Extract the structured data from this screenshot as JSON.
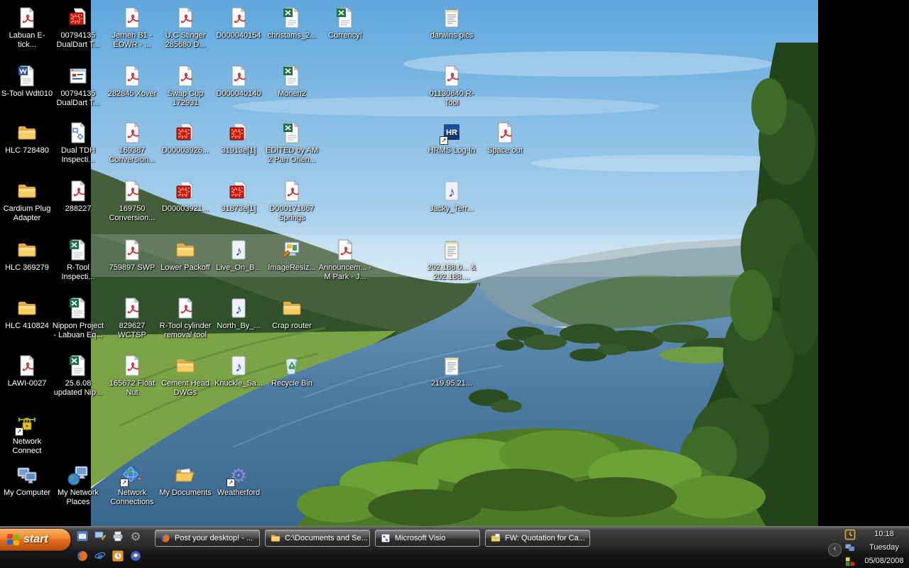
{
  "desktop": {
    "wallpaper_name": "queens-view-loch-tummel",
    "colors": {
      "side_bars": "#000000",
      "sky": "#5ea7dd",
      "water": "#4e7da4",
      "hills": "#44603b",
      "fields": "#7ca446"
    },
    "icons": [
      {
        "label": "Labuan E-tick...",
        "type": "pdf",
        "col": 1,
        "row": 1
      },
      {
        "label": "00794135 DualDart T...",
        "type": "dwg",
        "col": 2,
        "row": 1
      },
      {
        "label": "Jerneh B1 - EOWR - ...",
        "type": "pdf",
        "col": 3,
        "row": 1
      },
      {
        "label": "U.C Stinger 285680 D...",
        "type": "pdf",
        "col": 4,
        "row": 1
      },
      {
        "label": "D000040154",
        "type": "pdf",
        "col": 5,
        "row": 1
      },
      {
        "label": "christams_2...",
        "type": "xls",
        "col": 6,
        "row": 1
      },
      {
        "label": "Currency!",
        "type": "xls",
        "col": 7,
        "row": 1
      },
      {
        "label": "darwins pics",
        "type": "txt",
        "col": 8,
        "row": 1
      },
      {
        "label": "S-Tool Wdt010",
        "type": "doc",
        "col": 1,
        "row": 2
      },
      {
        "label": "00794135 DualDart T...",
        "type": "app",
        "col": 2,
        "row": 2
      },
      {
        "label": "282845 Xover",
        "type": "pdf",
        "col": 3,
        "row": 2
      },
      {
        "label": "Swap Cup 172931",
        "type": "pdf",
        "col": 4,
        "row": 2
      },
      {
        "label": "D000040140",
        "type": "pdf",
        "col": 5,
        "row": 2
      },
      {
        "label": "Moneh2",
        "type": "xls",
        "col": 6,
        "row": 2
      },
      {
        "label": "01130640 R-Tool",
        "type": "pdf",
        "col": 8,
        "row": 2
      },
      {
        "label": "HLC 728480",
        "type": "folder",
        "col": 1,
        "row": 3
      },
      {
        "label": "Dual TDH Inspecti...",
        "type": "visio",
        "col": 2,
        "row": 3
      },
      {
        "label": "169387 Conversion...",
        "type": "pdf",
        "col": 3,
        "row": 3
      },
      {
        "label": "D00003926...",
        "type": "dwg",
        "col": 4,
        "row": 3
      },
      {
        "label": "31913e[1]",
        "type": "dwg",
        "col": 5,
        "row": 3
      },
      {
        "label": "EDITED by AM 2 Pan Orien...",
        "type": "xls",
        "col": 6,
        "row": 3
      },
      {
        "label": "HRMS Log-In",
        "type": "hr",
        "col": 8,
        "row": 3,
        "shortcut": true
      },
      {
        "label": "Space out",
        "type": "pdf",
        "col": 9,
        "row": 3
      },
      {
        "label": "Cardium Plug Adapter",
        "type": "folder",
        "col": 1,
        "row": 4
      },
      {
        "label": "288227",
        "type": "pdf",
        "col": 2,
        "row": 4
      },
      {
        "label": "169750 Conversion...",
        "type": "pdf",
        "col": 3,
        "row": 4
      },
      {
        "label": "D00003921...",
        "type": "dwg",
        "col": 4,
        "row": 4
      },
      {
        "label": "31873e[1]",
        "type": "dwg",
        "col": 5,
        "row": 4
      },
      {
        "label": "D000171867 Springs",
        "type": "pdf",
        "col": 6,
        "row": 4
      },
      {
        "label": "Jacky_Terr...",
        "type": "music",
        "col": 8,
        "row": 4
      },
      {
        "label": "HLC 369279",
        "type": "folder",
        "col": 1,
        "row": 5
      },
      {
        "label": "R-Tool Inspecti...",
        "type": "xls",
        "col": 2,
        "row": 5
      },
      {
        "label": "759897 SWP",
        "type": "pdf",
        "col": 3,
        "row": 5
      },
      {
        "label": "Lower Packoff",
        "type": "folder",
        "col": 4,
        "row": 5
      },
      {
        "label": "Live_On_B...",
        "type": "music",
        "col": 5,
        "row": 5
      },
      {
        "label": "ImageResiz...",
        "type": "imgtool",
        "col": 6,
        "row": 5
      },
      {
        "label": "Announcem... - M Park - J...",
        "type": "pdf",
        "col": 7,
        "row": 5
      },
      {
        "label": "202.188.0... & 202.188....",
        "type": "txt",
        "col": 8,
        "row": 5
      },
      {
        "label": "HLC 410824",
        "type": "folder",
        "col": 1,
        "row": 6
      },
      {
        "label": "Nippon Project - Labuan Eq...",
        "type": "xls",
        "col": 2,
        "row": 6
      },
      {
        "label": "829627 WCTSP",
        "type": "pdf",
        "col": 3,
        "row": 6
      },
      {
        "label": "R-Tool cylinder removal tool",
        "type": "pdf",
        "col": 4,
        "row": 6
      },
      {
        "label": "North_By_...",
        "type": "music",
        "col": 5,
        "row": 6
      },
      {
        "label": "Crap router",
        "type": "folder",
        "col": 6,
        "row": 6
      },
      {
        "label": "LAWI-0027",
        "type": "pdf",
        "col": 1,
        "row": 7
      },
      {
        "label": "25.6.08 updated Nip...",
        "type": "xls",
        "col": 2,
        "row": 7
      },
      {
        "label": "165672 Float Nut",
        "type": "pdf",
        "col": 3,
        "row": 7
      },
      {
        "label": "Cement Head DWGs",
        "type": "folder",
        "col": 4,
        "row": 7
      },
      {
        "label": "Knuckle_Sa...",
        "type": "music",
        "col": 5,
        "row": 7
      },
      {
        "label": "Recycle Bin",
        "type": "recycle",
        "col": 6,
        "row": 7
      },
      {
        "label": "219.95.21...",
        "type": "txt",
        "col": 8,
        "row": 7
      },
      {
        "label": "Network Connect",
        "type": "locknet",
        "col": 1,
        "row": 8,
        "shortcut": true
      },
      {
        "label": "My Computer",
        "type": "mycomputer",
        "col": 1,
        "row": 9
      },
      {
        "label": "My Network Places",
        "type": "netplaces",
        "col": 2,
        "row": 9
      },
      {
        "label": "Network Connections",
        "type": "netconn",
        "col": 3,
        "row": 9,
        "shortcut": true
      },
      {
        "label": "My Documents",
        "type": "mydocs",
        "col": 4,
        "row": 9
      },
      {
        "label": "Weatherford",
        "type": "gear",
        "col": 5,
        "row": 9,
        "shortcut": true
      }
    ]
  },
  "taskbar": {
    "start_label": "start",
    "accent_color": "#f08a33",
    "bar_color": "#2b2b2b",
    "quick_launch": [
      {
        "name": "outlook-express-icon",
        "type": "oemail",
        "slot": 1
      },
      {
        "name": "show-desktop-icon",
        "type": "showdesktop",
        "slot": 2
      },
      {
        "name": "printer-icon",
        "type": "printer",
        "slot": 3
      },
      {
        "name": "settings-gear-icon",
        "type": "geargray",
        "slot": 4
      },
      {
        "name": "firefox-icon",
        "type": "firefox",
        "slot": 5
      },
      {
        "name": "internet-explorer-icon",
        "type": "ie",
        "slot": 6
      },
      {
        "name": "clock-app-icon",
        "type": "clockapp",
        "slot": 7
      },
      {
        "name": "media-player-icon",
        "type": "wmp",
        "slot": 8
      }
    ],
    "tasks": [
      {
        "label": "Post your desktop! - ...",
        "icon": "firefox"
      },
      {
        "label": "C:\\Documents and Se...",
        "icon": "folder"
      },
      {
        "label": "Microsoft Visio",
        "icon": "visioapp"
      },
      {
        "label": "FW: Quotation for Ca...",
        "icon": "outlook"
      }
    ],
    "tray": {
      "chevron": "‹",
      "icons": [
        {
          "name": "tray-clock-icon",
          "type": "trayclock"
        },
        {
          "name": "tray-network-icon",
          "type": "traynet"
        },
        {
          "name": "tray-color-grid-icon",
          "type": "trayquad"
        }
      ],
      "time": "10:18",
      "day": "Tuesday",
      "date": "05/08/2008"
    }
  }
}
